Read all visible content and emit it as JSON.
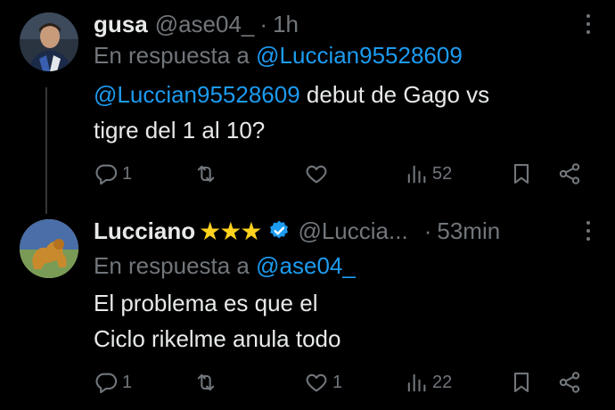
{
  "tweets": [
    {
      "name": "gusa",
      "handle": "@ase04_",
      "time": "1h",
      "reply_prefix": "En respuesta a",
      "reply_to": "@Luccian95528609",
      "mention": "@Luccian95528609",
      "text_line1": " debut de Gago vs",
      "text_line2": "tigre del 1 al 10?",
      "replies": "1",
      "retweets": "",
      "likes": "",
      "views": "52"
    },
    {
      "name": "Lucciano",
      "stars": "★★★",
      "handle": "@Luccia...",
      "time": "53min",
      "reply_prefix": "En respuesta a",
      "reply_to": "@ase04_",
      "text_line1": "El problema es que el",
      "text_line2": "Ciclo rikelme anula todo",
      "replies": "1",
      "retweets": "",
      "likes": "1",
      "views": "22"
    }
  ],
  "colors": {
    "background": "#000000",
    "text": "#e7e9ea",
    "muted": "#71767b",
    "link": "#1d9bf0",
    "star": "#ffd21e"
  },
  "icons": [
    "reply-icon",
    "retweet-icon",
    "like-icon",
    "views-icon",
    "bookmark-icon",
    "share-icon",
    "more-icon",
    "verified-icon"
  ]
}
